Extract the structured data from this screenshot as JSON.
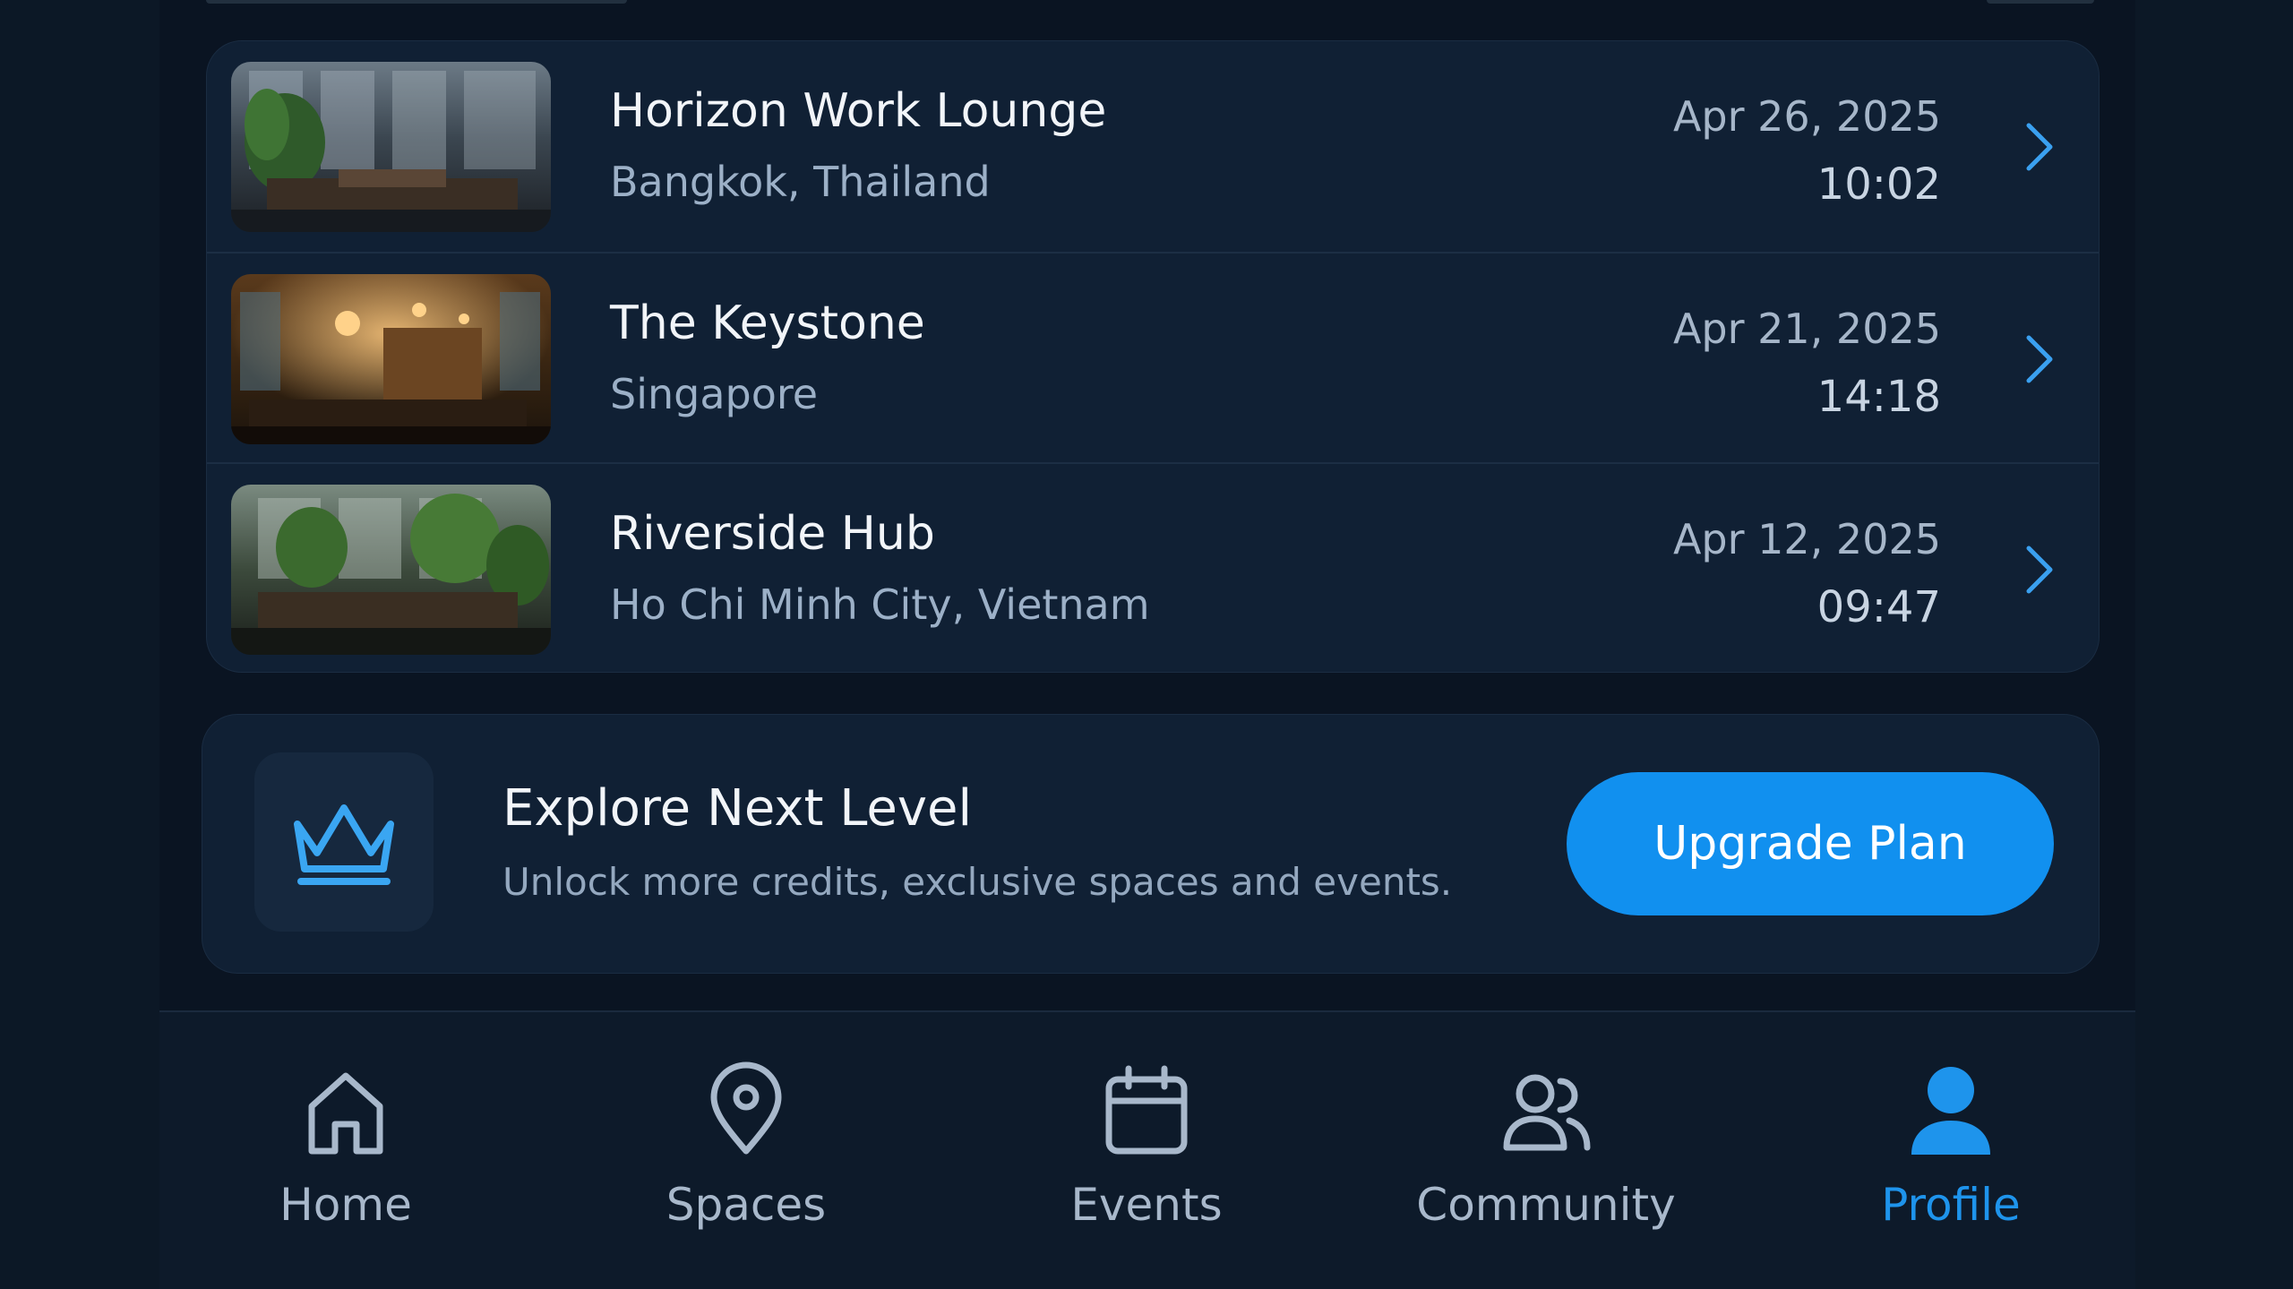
{
  "recent_visits": [
    {
      "name": "Horizon Work Lounge",
      "location": "Bangkok, Thailand",
      "date": "Apr 26, 2025",
      "time": "10:02"
    },
    {
      "name": "The Keystone",
      "location": "Singapore",
      "date": "Apr 21, 2025",
      "time": "14:18"
    },
    {
      "name": "Riverside Hub",
      "location": "Ho Chi Minh City, Vietnam",
      "date": "Apr 12, 2025",
      "time": "09:47"
    }
  ],
  "upgrade": {
    "icon": "crown-icon",
    "title": "Explore Next Level",
    "subtitle": "Unlock more credits, exclusive spaces and events.",
    "button_label": "Upgrade Plan"
  },
  "bottom_nav": {
    "active": "Profile",
    "items": [
      {
        "label": "Home",
        "icon": "home-icon"
      },
      {
        "label": "Spaces",
        "icon": "map-pin-icon"
      },
      {
        "label": "Events",
        "icon": "calendar-icon"
      },
      {
        "label": "Community",
        "icon": "users-icon"
      },
      {
        "label": "Profile",
        "icon": "user-icon"
      }
    ]
  },
  "colors": {
    "background": "#0c1826",
    "card": "#102034",
    "accent": "#1190ef",
    "active_nav": "#1e94ec",
    "text_primary": "#f2f5f9",
    "text_secondary": "#9cb0c7"
  }
}
